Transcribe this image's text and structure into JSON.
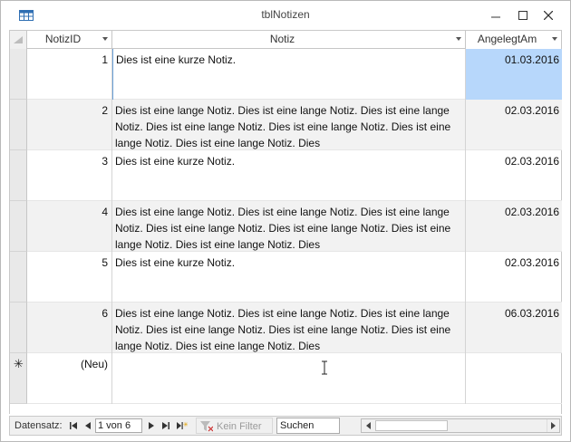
{
  "window": {
    "title": "tblNotizen",
    "icon": "table-icon",
    "controls": [
      "minimize-icon",
      "maximize-icon",
      "close-icon"
    ]
  },
  "columns": [
    {
      "label": "NotizID"
    },
    {
      "label": "Notiz"
    },
    {
      "label": "AngelegtAm"
    }
  ],
  "rows": [
    {
      "id": "1",
      "notiz": "Dies ist eine kurze Notiz.",
      "date": "01.03.2016"
    },
    {
      "id": "2",
      "notiz": "Dies ist eine lange Notiz. Dies ist eine lange Notiz. Dies ist eine lange Notiz. Dies ist eine lange Notiz. Dies ist eine lange Notiz. Dies ist eine lange Notiz. Dies ist eine lange Notiz. Dies",
      "date": "02.03.2016"
    },
    {
      "id": "3",
      "notiz": "Dies ist eine kurze Notiz.",
      "date": "02.03.2016"
    },
    {
      "id": "4",
      "notiz": "Dies ist eine lange Notiz. Dies ist eine lange Notiz. Dies ist eine lange Notiz. Dies ist eine lange Notiz. Dies ist eine lange Notiz. Dies ist eine lange Notiz. Dies ist eine lange Notiz. Dies",
      "date": "02.03.2016"
    },
    {
      "id": "5",
      "notiz": "Dies ist eine kurze Notiz.",
      "date": "02.03.2016"
    },
    {
      "id": "6",
      "notiz": "Dies ist eine lange Notiz. Dies ist eine lange Notiz. Dies ist eine lange Notiz. Dies ist eine lange Notiz. Dies ist eine lange Notiz. Dies ist eine lange Notiz. Dies ist eine lange Notiz. Dies",
      "date": "06.03.2016"
    }
  ],
  "new_row": {
    "marker": "✳",
    "label": "(Neu)"
  },
  "navigation": {
    "label": "Datensatz:",
    "record": "1 von 6",
    "filter": "Kein Filter",
    "search": "Suchen"
  },
  "colors": {
    "selected_cell": "#b7d7fb",
    "alt_row": "#f2f2f2"
  }
}
